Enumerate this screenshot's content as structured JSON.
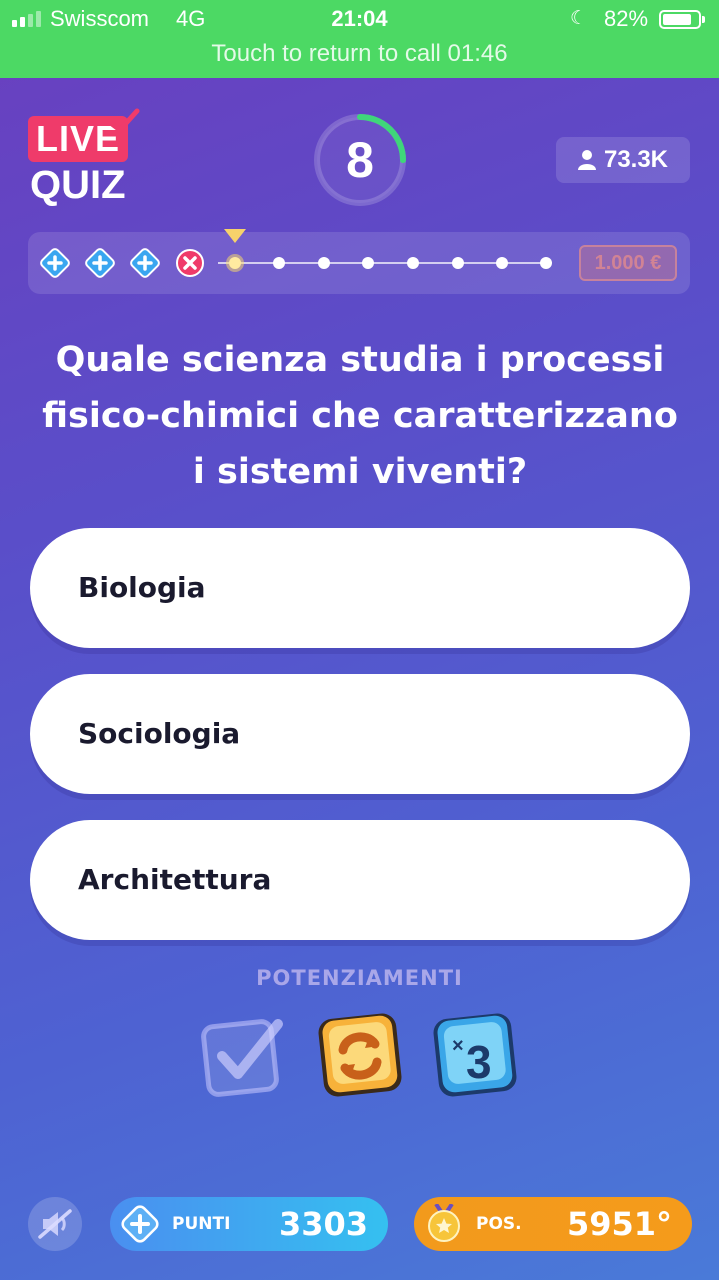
{
  "status_bar": {
    "carrier": "Swisscom",
    "network": "4G",
    "time": "21:04",
    "battery": "82%",
    "battery_level": 0.82,
    "call_banner": "Touch to return to call 01:46",
    "colors": {
      "background": "#4cd964"
    }
  },
  "header": {
    "logo_live": "LIVE",
    "logo_quiz": "QUIZ",
    "timer_value": "8",
    "timer_progress": 0.25,
    "players_count": "73.3K"
  },
  "progress": {
    "completed": [
      "correct",
      "correct",
      "correct",
      "wrong"
    ],
    "remaining_steps": 8,
    "prize": "1.000 €"
  },
  "question": {
    "text_line1": "Quale scienza studia i processi",
    "text_line2": "fisico-chimici che caratterizzano",
    "text_line3": "i sistemi viventi?"
  },
  "answers": [
    {
      "label": "Biologia"
    },
    {
      "label": "Sociologia"
    },
    {
      "label": "Architettura"
    }
  ],
  "powerups": {
    "title": "POTENZIAMENTI",
    "items": [
      {
        "icon": "checkmark-powerup-icon",
        "state": "disabled"
      },
      {
        "icon": "swap-powerup-icon",
        "state": "available"
      },
      {
        "icon": "times-three-powerup-icon",
        "state": "available"
      }
    ]
  },
  "footer": {
    "points_label": "PUNTI",
    "points_value": "3303",
    "position_label": "POS.",
    "position_value": "5951°"
  },
  "colors": {
    "accent_pink": "#ef3b6a",
    "timer_green": "#3fd67a",
    "points_blue": "#3aa6f0",
    "position_orange": "#f29a1c"
  }
}
